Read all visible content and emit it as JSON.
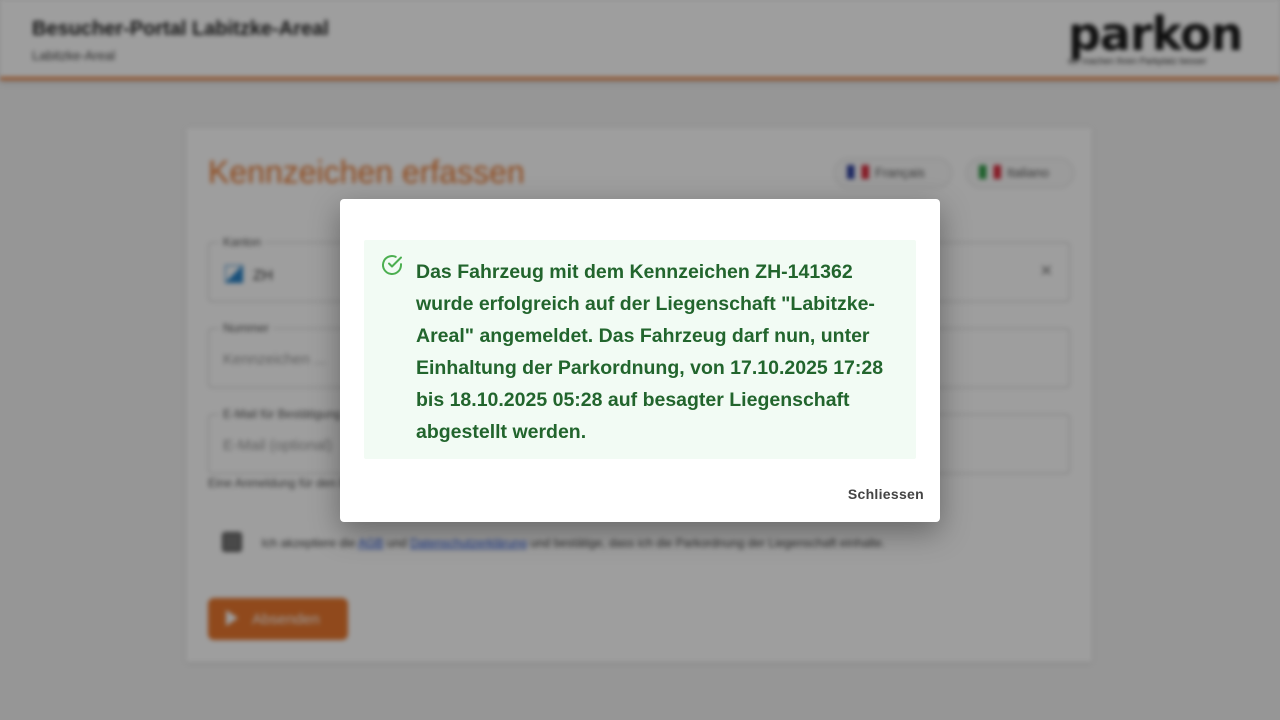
{
  "header": {
    "title": "Besucher-Portal Labitzke-Areal",
    "subtitle": "Labitzke-Areal",
    "logo_text": "parkon",
    "logo_tagline": "wir machen Ihren Parkplatz besser"
  },
  "form": {
    "title": "Kennzeichen erfassen",
    "lang_fr": "Français",
    "lang_it": "Italiano",
    "canton_label": "Kanton",
    "canton_value": "ZH",
    "number_label": "Nummer",
    "number_placeholder": "Kennzeichen ...",
    "email_label": "E-Mail für Bestätigung",
    "email_placeholder": "E-Mail (optional)",
    "hint": "Eine Anmeldung für den Besucherparkplatz ist nötig.",
    "consent_prefix": "Ich akzeptiere die",
    "consent_link_1": "AGB",
    "consent_middle": "und",
    "consent_link_2": "Datenschutzerklärung",
    "consent_suffix": "und bestätige, dass ich die Parkordnung der Liegenschaft einhalte.",
    "submit_label": "Absenden"
  },
  "dialog": {
    "message": "Das Fahrzeug mit dem Kennzeichen ZH-141362 wurde erfolgreich auf der Liegenschaft \"Labitzke-Areal\" angemeldet. Das Fahrzeug darf nun, unter Einhaltung der Parkordnung, von 17.10.2025 17:28 bis 18.10.2025 05:28 auf besagter Liegenschaft abgestellt werden.",
    "close_label": "Schliessen",
    "icon": "check-circle-icon"
  },
  "colors": {
    "accent": "#e8772e",
    "success_text": "#22652d",
    "success_bg": "#f2fbf4",
    "success_icon": "#4caf50"
  }
}
